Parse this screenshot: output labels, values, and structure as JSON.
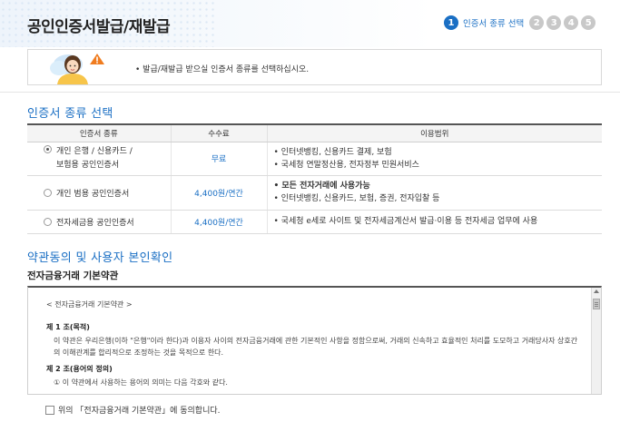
{
  "page_title": "공인인증서발급/재발급",
  "steps": [
    {
      "num": "1",
      "label": "인증서 종류 선택",
      "active": true
    },
    {
      "num": "2",
      "active": false
    },
    {
      "num": "3",
      "active": false
    },
    {
      "num": "4",
      "active": false
    },
    {
      "num": "5",
      "active": false
    }
  ],
  "notice": {
    "text_prefix": "• 발급/재발급 받으실 인증서 종류",
    "text_suffix": "를 선택하십시오."
  },
  "section1": {
    "title": "인증서 종류 선택",
    "columns": [
      "인증서 종류",
      "수수료",
      "이용범위"
    ],
    "rows": [
      {
        "name_line1": "개인 은행 / 신용카드 /",
        "name_line2": "보험용 공인인증서",
        "fee": "무료",
        "usage1": "인터넷뱅킹, 신용카드 결제, 보험",
        "usage2": "국세청 연말정산용, 전자정부 민원서비스",
        "selected": true
      },
      {
        "name_line1": "개인 범용 공인인증서",
        "fee": "4,400원/연간",
        "usage1": "모든 전자거래에 사용가능",
        "usage2": "인터넷뱅킹, 신용카드, 보험, 증권, 전자입찰 등",
        "selected": false
      },
      {
        "name_line1": "전자세금용 공인인증서",
        "fee": "4,400원/연간",
        "usage1": "국세청 e세로 사이트 및 전자세금계산서 발급·이용 등 전자세금 업무에 사용",
        "selected": false
      }
    ]
  },
  "section2": {
    "title": "약관동의 및 사용자 본인확인",
    "subtitle": "전자금융거래 기본약관",
    "doc_title": "< 전자금융거래 기본약관 >",
    "art1_title": "제 1 조(목적)",
    "art1_body": "이 약관은 우리은행(이하 \"은행\"이라 한다)과 이용자 사이의 전자금융거래에 관한 기본적인 사항을 정함으로써, 거래의 신속하고 효율적인 처리를 도모하고 거래당사자 상호간의 이해관계를 합리적으로 조정하는 것을 목적으로 한다.",
    "art2_title": "제 2 조(용어의 정의)",
    "art2_body": "① 이 약관에서 사용하는 용어의 의미는 다음 각호와 같다.",
    "agree_label": "위의 「전자금융거래 기본약관」에 동의합니다."
  }
}
